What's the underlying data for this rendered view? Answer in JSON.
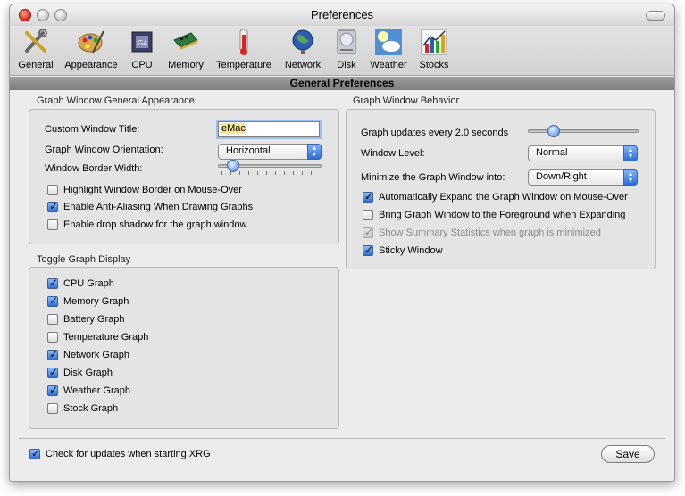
{
  "window": {
    "title": "Preferences"
  },
  "toolbar": {
    "items": [
      {
        "label": "General",
        "icon": "general-icon"
      },
      {
        "label": "Appearance",
        "icon": "appearance-icon"
      },
      {
        "label": "CPU",
        "icon": "cpu-icon"
      },
      {
        "label": "Memory",
        "icon": "memory-icon"
      },
      {
        "label": "Temperature",
        "icon": "temperature-icon"
      },
      {
        "label": "Network",
        "icon": "network-icon"
      },
      {
        "label": "Disk",
        "icon": "disk-icon"
      },
      {
        "label": "Weather",
        "icon": "weather-icon"
      },
      {
        "label": "Stocks",
        "icon": "stocks-icon"
      }
    ]
  },
  "section": {
    "title": "General Preferences"
  },
  "appearance": {
    "title": "Graph Window General Appearance",
    "custom_title_label": "Custom Window Title:",
    "custom_title_value": "eMac",
    "orientation_label": "Graph Window Orientation:",
    "orientation_value": "Horizontal",
    "border_width_label": "Window Border Width:",
    "border_width_value": 0.1,
    "checks": [
      {
        "label": "Highlight Window Border on Mouse-Over",
        "checked": false
      },
      {
        "label": "Enable Anti-Aliasing When Drawing Graphs",
        "checked": true
      },
      {
        "label": "Enable drop shadow for the graph window.",
        "checked": false
      }
    ]
  },
  "toggle": {
    "title": "Toggle Graph Display",
    "checks": [
      {
        "label": "CPU Graph",
        "checked": true
      },
      {
        "label": "Memory Graph",
        "checked": true
      },
      {
        "label": "Battery Graph",
        "checked": false
      },
      {
        "label": "Temperature Graph",
        "checked": false
      },
      {
        "label": "Network Graph",
        "checked": true
      },
      {
        "label": "Disk Graph",
        "checked": true
      },
      {
        "label": "Weather Graph",
        "checked": true
      },
      {
        "label": "Stock Graph",
        "checked": false
      }
    ]
  },
  "behavior": {
    "title": "Graph Window Behavior",
    "updates_label": "Graph updates every 2.0 seconds",
    "updates_value": 0.2,
    "level_label": "Window Level:",
    "level_value": "Normal",
    "minimize_label": "Minimize the Graph Window into:",
    "minimize_value": "Down/Right",
    "checks": [
      {
        "label": "Automatically Expand the Graph Window on Mouse-Over",
        "checked": true,
        "disabled": false
      },
      {
        "label": "Bring Graph Window to the Foreground when Expanding",
        "checked": false,
        "disabled": false
      },
      {
        "label": "Show Summary Statistics when graph is minimized",
        "checked": true,
        "disabled": true
      },
      {
        "label": "Sticky Window",
        "checked": true,
        "disabled": false
      }
    ]
  },
  "footer": {
    "check_updates_label": "Check for updates when starting XRG",
    "check_updates_checked": true,
    "save_label": "Save"
  }
}
